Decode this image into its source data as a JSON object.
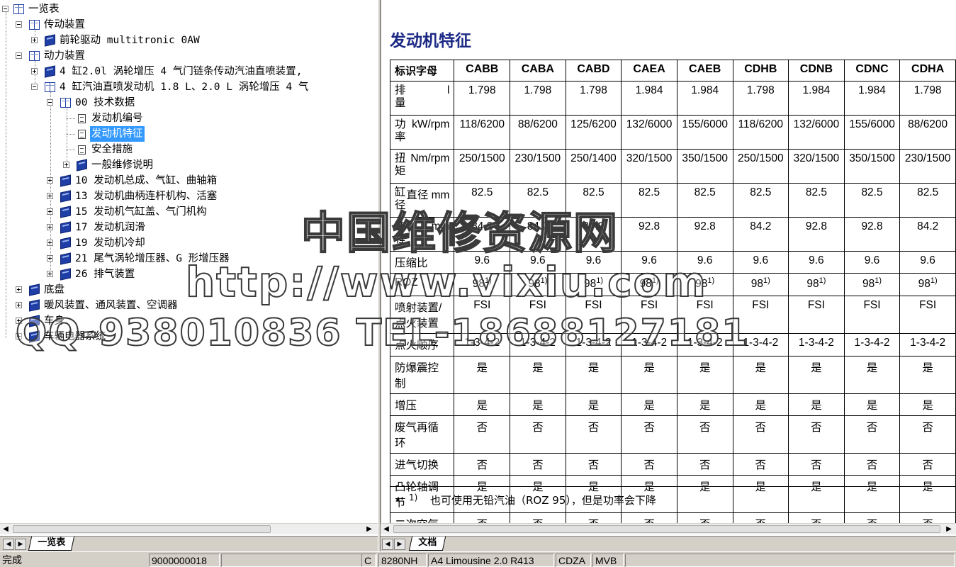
{
  "tree": {
    "root": "一览表",
    "items": [
      {
        "label": "传动装置"
      },
      {
        "label": "前轮驱动 multitronic 0AW"
      },
      {
        "label": "动力装置"
      },
      {
        "label": "4 缸2.0l 涡轮增压 4 气门链条传动汽油直喷装置,"
      },
      {
        "label": "4 缸汽油直喷发动机 1.8 L、2.0 L 涡轮增压 4 气"
      },
      {
        "label": "00 技术数据"
      },
      {
        "label": "发动机编号"
      },
      {
        "label": "发动机特征"
      },
      {
        "label": "安全措施"
      },
      {
        "label": "一般维修说明"
      },
      {
        "label": "10 发动机总成、气缸、曲轴箱"
      },
      {
        "label": "13 发动机曲柄连杆机构、活塞"
      },
      {
        "label": "15 发动机气缸盖、气门机构"
      },
      {
        "label": "17 发动机润滑"
      },
      {
        "label": "19 发动机冷却"
      },
      {
        "label": "21 尾气涡轮增压器、G 形增压器"
      },
      {
        "label": "26 排气装置"
      },
      {
        "label": "底盘"
      },
      {
        "label": "暖风装置、通风装置、空调器"
      },
      {
        "label": "车身"
      },
      {
        "label": "车辆电器系统"
      }
    ]
  },
  "document": {
    "title": "发动机特征",
    "table": {
      "corner": "标识字母",
      "columns": [
        "CABB",
        "CABA",
        "CABD",
        "CAEA",
        "CAEB",
        "CDHB",
        "CDNB",
        "CDNC",
        "CDHA"
      ],
      "rows": [
        {
          "label": "排量",
          "unit": "l",
          "values": [
            "1.798",
            "1.798",
            "1.798",
            "1.984",
            "1.984",
            "1.798",
            "1.984",
            "1.984",
            "1.798"
          ]
        },
        {
          "label": "功率",
          "unit": "kW/rpm",
          "values": [
            "118/6200",
            "88/6200",
            "125/6200",
            "132/6000",
            "155/6000",
            "118/6200",
            "132/6000",
            "155/6000",
            "88/6200"
          ]
        },
        {
          "label": "扭矩",
          "unit": "Nm/rpm",
          "values": [
            "250/1500",
            "230/1500",
            "250/1400",
            "320/1500",
            "350/1500",
            "250/1500",
            "320/1500",
            "350/1500",
            "230/1500"
          ]
        },
        {
          "label": "缸径",
          "unit": "直径 mm",
          "values": [
            "82.5",
            "82.5",
            "82.5",
            "82.5",
            "82.5",
            "82.5",
            "82.5",
            "82.5",
            "82.5"
          ]
        },
        {
          "label": "冲程",
          "unit": "mm",
          "values": [
            "84.2",
            "84.2",
            "84.2",
            "92.8",
            "92.8",
            "84.2",
            "92.8",
            "92.8",
            "84.2"
          ]
        },
        {
          "label": "压缩比",
          "unit": "",
          "values": [
            "9.6",
            "9.6",
            "9.6",
            "9.6",
            "9.6",
            "9.6",
            "9.6",
            "9.6",
            "9.6"
          ]
        },
        {
          "label": "ROZ",
          "unit": "",
          "values": [
            "98",
            "98",
            "98",
            "98",
            "98",
            "98",
            "98",
            "98",
            "98"
          ],
          "note": "1)"
        },
        {
          "label": "喷射装置/点火装置",
          "unit": "",
          "values": [
            "FSI",
            "FSI",
            "FSI",
            "FSI",
            "FSI",
            "FSI",
            "FSI",
            "FSI",
            "FSI"
          ]
        },
        {
          "label": "点火顺序",
          "unit": "",
          "values": [
            "1-3-4-2",
            "1-3-4-2",
            "1-3-4-2",
            "1-3-4-2",
            "1-3-4-2",
            "1-3-4-2",
            "1-3-4-2",
            "1-3-4-2",
            "1-3-4-2"
          ]
        },
        {
          "label": "防爆震控制",
          "unit": "",
          "values": [
            "是",
            "是",
            "是",
            "是",
            "是",
            "是",
            "是",
            "是",
            "是"
          ]
        },
        {
          "label": "增压",
          "unit": "",
          "values": [
            "是",
            "是",
            "是",
            "是",
            "是",
            "是",
            "是",
            "是",
            "是"
          ]
        },
        {
          "label": "废气再循环",
          "unit": "",
          "values": [
            "否",
            "否",
            "否",
            "否",
            "否",
            "否",
            "否",
            "否",
            "否"
          ]
        },
        {
          "label": "进气切换",
          "unit": "",
          "values": [
            "否",
            "否",
            "否",
            "否",
            "否",
            "否",
            "否",
            "否",
            "否"
          ]
        },
        {
          "label": "凸轮轴调节",
          "unit": "",
          "values": [
            "是",
            "是",
            "是",
            "是",
            "是",
            "是",
            "是",
            "是",
            "是"
          ]
        },
        {
          "label": "二次空气喷射",
          "unit": "",
          "values": [
            "否",
            "否",
            "否",
            "否",
            "否",
            "否",
            "否",
            "否",
            "否"
          ]
        }
      ]
    },
    "footnote": {
      "bullet": "•",
      "ref": "1)",
      "text": "也可使用无铅汽油（ROZ 95），但是功率会下降"
    }
  },
  "tabs": {
    "left": "一览表",
    "right": "文档"
  },
  "statusbar": {
    "status": "完成",
    "code": "9000000018",
    "flag": "C",
    "model_code": "8280NH",
    "vehicle": "A4 Limousine 2.0 R413",
    "engine": "CDZA",
    "gearbox": "MVB"
  },
  "watermark": {
    "line1": "中国维修资源网",
    "line2": "http://www.vixiu.com",
    "line3": "QQ-938010836 TEL-18688127181"
  }
}
